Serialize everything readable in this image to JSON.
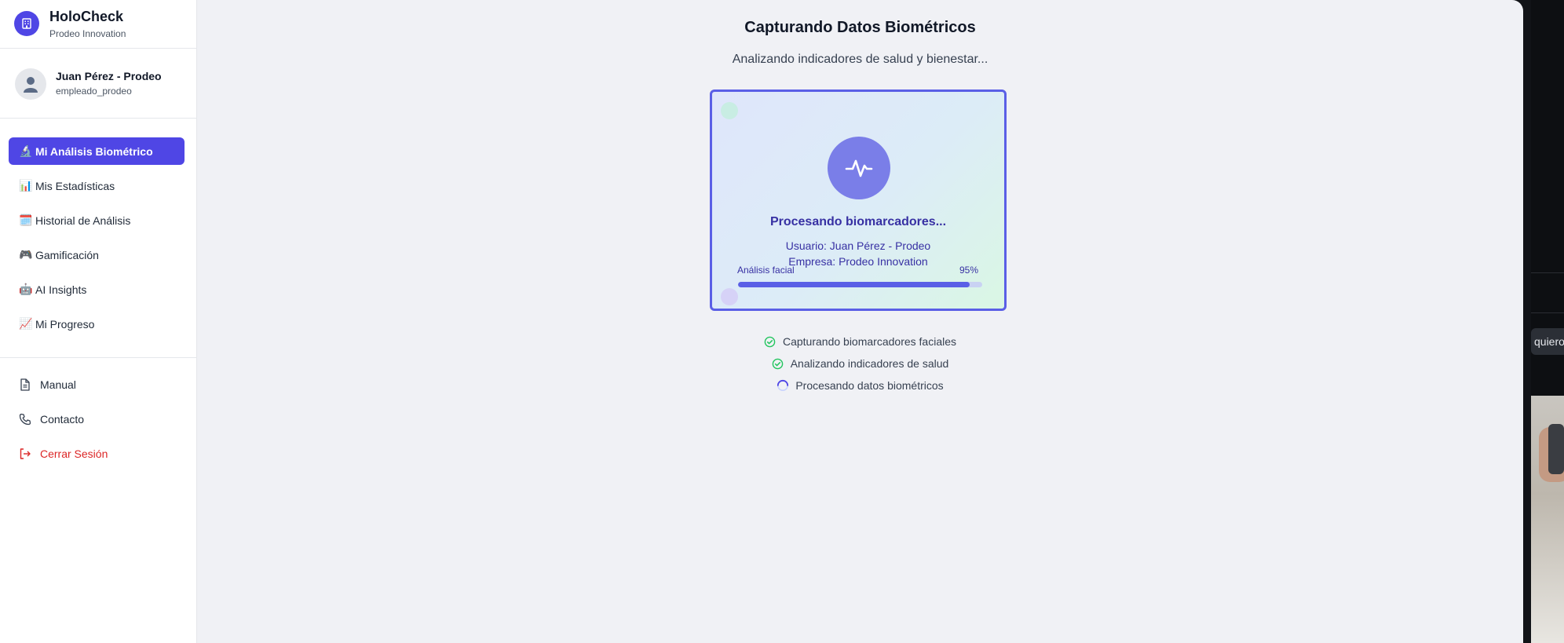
{
  "brand": {
    "title": "HoloCheck",
    "subtitle": "Prodeo Innovation",
    "logo_icon": "building-icon"
  },
  "user": {
    "name": "Juan Pérez - Prodeo",
    "handle": "empleado_prodeo",
    "avatar_icon": "user-avatar-icon"
  },
  "nav": {
    "items": [
      {
        "emoji": "🔬",
        "label": "Mi Análisis Biométrico",
        "active": true
      },
      {
        "emoji": "📊",
        "label": "Mis Estadísticas"
      },
      {
        "emoji": "🗓️",
        "label": "Historial de Análisis"
      },
      {
        "emoji": "🎮",
        "label": "Gamificación"
      },
      {
        "emoji": "🤖",
        "label": "AI Insights"
      },
      {
        "emoji": "📈",
        "label": "Mi Progreso"
      }
    ]
  },
  "footer": {
    "manual": {
      "label": "Manual",
      "icon": "document-icon"
    },
    "contact": {
      "label": "Contacto",
      "icon": "phone-icon"
    },
    "logout": {
      "label": "Cerrar Sesión",
      "icon": "logout-icon"
    }
  },
  "main": {
    "title": "Capturando Datos Biométricos",
    "subtitle": "Analizando indicadores de salud y bienestar...",
    "card": {
      "icon": "activity-pulse-icon",
      "status": "Procesando biomarcadores...",
      "user_line": "Usuario: Juan Pérez - Prodeo",
      "company_line": "Empresa: Prodeo Innovation",
      "progress_label": "Análisis facial",
      "progress_text": "95%",
      "progress_value": 95
    },
    "steps": [
      {
        "label": "Capturando biomarcadores faciales",
        "state": "done",
        "icon": "check-circle-icon"
      },
      {
        "label": "Analizando indicadores de salud",
        "state": "done",
        "icon": "check-circle-icon"
      },
      {
        "label": "Procesando datos biométricos",
        "state": "loading",
        "icon": "spinner-icon"
      }
    ]
  },
  "side_panel": {
    "chip_text": "quiero"
  },
  "colors": {
    "accent": "#4f46e5",
    "card_border": "#5a5fe6",
    "logout": "#dc2626",
    "success": "#22c55e"
  }
}
